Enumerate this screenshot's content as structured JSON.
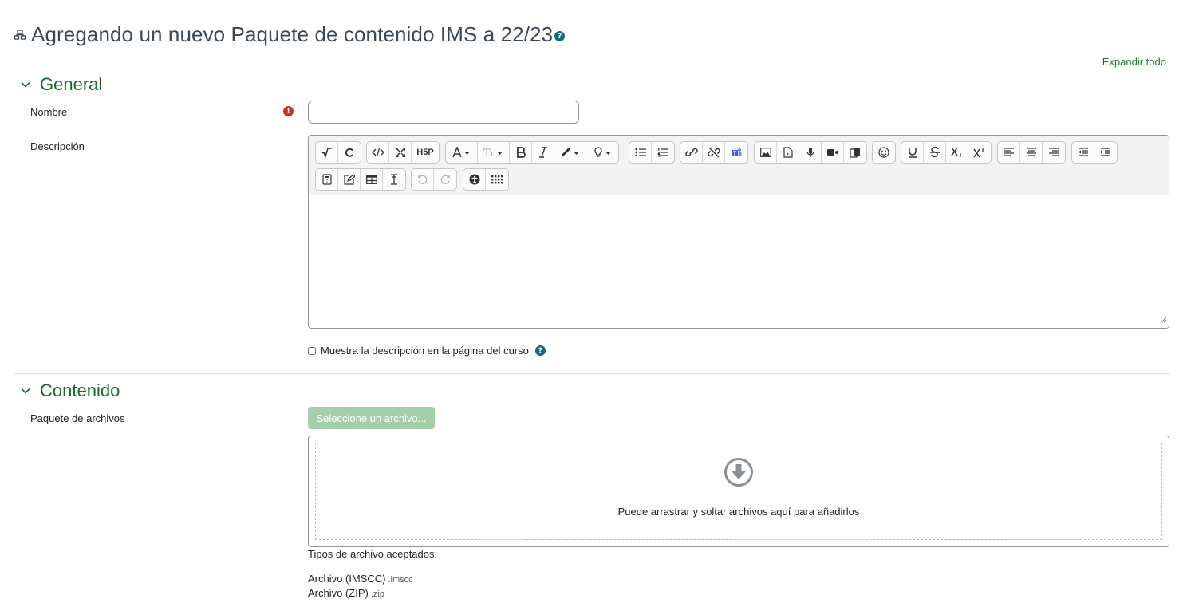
{
  "header": {
    "title": "Agregando un nuevo Paquete de contenido IMS a 22/23",
    "module_icon": "package-icon",
    "help_glyph": "?"
  },
  "expand_all": "Expandir todo",
  "sections": {
    "general": {
      "title": "General"
    },
    "contenido": {
      "title": "Contenido"
    }
  },
  "fields": {
    "nombre": {
      "label": "Nombre",
      "value": "",
      "required_glyph": "!"
    },
    "descripcion": {
      "label": "Descripción"
    },
    "show_description": {
      "label": "Muestra la descripción en la página del curso",
      "checked": false
    },
    "paquete": {
      "label": "Paquete de archivos",
      "button": "Seleccione un archivo...",
      "drop_text": "Puede arrastrar y soltar archivos aquí para añadirlos",
      "accepted_title": "Tipos de archivo aceptados:",
      "accepted": [
        {
          "name": "Archivo (IMSCC)",
          "ext": ".imscc"
        },
        {
          "name": "Archivo (ZIP)",
          "ext": ".zip"
        }
      ]
    }
  },
  "toolbar": {
    "h5p_label": "H5P",
    "row1_groups": [
      [
        "equation-icon",
        "chemistry-icon"
      ],
      [
        "html-icon",
        "fullscreen-icon",
        "h5p-icon"
      ],
      [
        "font-color-icon",
        "font-size-icon",
        "bold-icon",
        "italic-icon",
        "background-color-icon",
        "hint-icon"
      ],
      [
        "unordered-list-icon",
        "ordered-list-icon"
      ],
      [
        "link-icon",
        "unlink-icon",
        "teams-icon"
      ],
      [
        "image-icon",
        "media-icon",
        "record-audio-icon",
        "record-video-icon",
        "manage-files-icon"
      ],
      [
        "emoji-icon"
      ],
      [
        "underline-icon",
        "strikethrough-icon",
        "subscript-icon",
        "superscript-icon"
      ],
      [
        "align-left-icon",
        "align-center-icon",
        "align-right-icon"
      ],
      [
        "outdent-icon",
        "indent-icon"
      ]
    ],
    "row2_groups": [
      [
        "calculator-icon",
        "edit-icon",
        "table-icon",
        "clear-format-icon"
      ],
      [
        "undo-icon",
        "redo-icon"
      ],
      [
        "accessibility-icon",
        "more-icon"
      ]
    ]
  },
  "colors": {
    "accent_green": "#1a6b2b",
    "link_green": "#1a7a2f",
    "help_teal": "#0f6c7c",
    "required_red": "#c9302c",
    "button_disabled_green": "#a5cfaa"
  }
}
